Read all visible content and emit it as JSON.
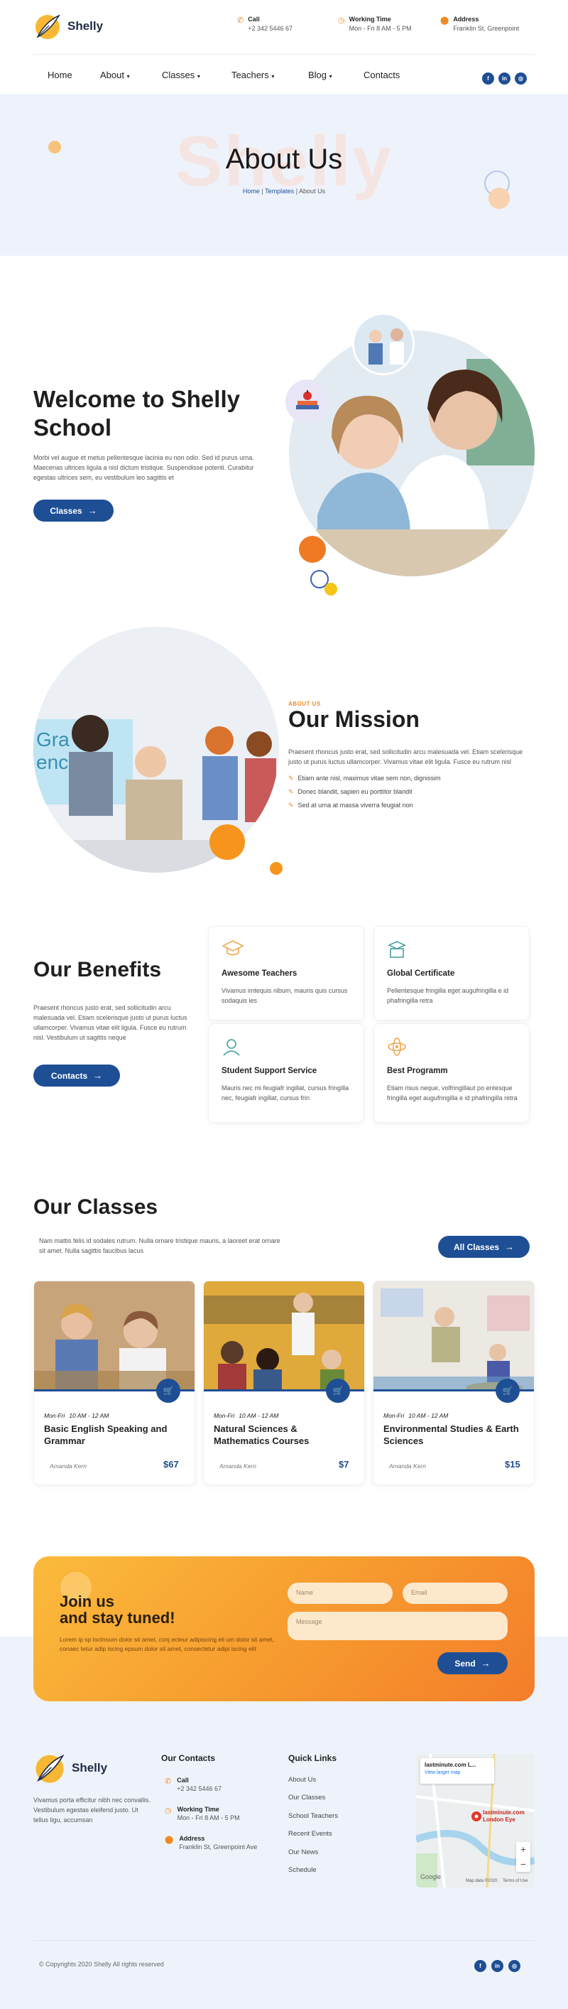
{
  "brand": {
    "name": "Shelly"
  },
  "header": {
    "call": {
      "label": "Call",
      "value": "+2 342 5446 67"
    },
    "hours": {
      "label": "Working Time",
      "value": "Mon - Fri 8 AM - 5 PM"
    },
    "address": {
      "label": "Address",
      "value": "Franklin St, Greenpoint"
    }
  },
  "nav": {
    "items": [
      "Home",
      "About",
      "Classes",
      "Teachers",
      "Blog",
      "Contacts"
    ]
  },
  "social": {
    "facebook": "f",
    "linkedin": "in",
    "instagram": "◎"
  },
  "hero": {
    "bg_text": "Shelly",
    "title": "About Us",
    "crumb_home": "Home",
    "crumb_sep1": "|",
    "crumb_templates": "Templates",
    "crumb_sep2": "|",
    "crumb_current": "About Us"
  },
  "welcome": {
    "title_line1": "Welcome to Shelly",
    "title_line2": "School",
    "text": "Morbi vel augue et metus pellentesque lacinia eu non odio. Sed id purus urna. Maecenas ultrices ligula a nisl dictum tristique. Suspendisse potenti. Curabitur egestas ultrices sem, eu vestibulum leo sagittis et",
    "button": "Classes"
  },
  "mission": {
    "eyebrow": "ABOUT US",
    "title": "Our Mission",
    "text": "Praesent rhoncus justo erat, sed sollicitudin arcu malesuada vel. Etiam scelerisque justo ut purus luctus ullamcorper. Vivamus vitae elit ligula. Fusce eu rutrum nisl",
    "bullets": [
      "Etiam ante nisl, maximus vitae sem non, dignissim",
      "Donec blandit, sapien eu porttitor blandit",
      "Sed at urna at massa viverra feugiat non"
    ],
    "image_text": "Gra\nenc"
  },
  "benefits": {
    "title": "Our Benefits",
    "text": "Praesent rhoncus justo erat, sed sollicitudin arcu malesuada vel. Etiam scelerisque justo ut purus luctus ullamcorper. Vivamus vitae elit ligula. Fusce eu rutrum nisl. Vestibulum ut sagittis neque",
    "button": "Contacts",
    "cards": [
      {
        "title": "Awesome Teachers",
        "text": "Vivamus imtequis nibum, mauris quis cursus sodaquis ies",
        "icon": "graduation-cap-icon"
      },
      {
        "title": "Global Certificate",
        "text": "Pellentesque fringilla eget augufringilla e id phafringilla retra",
        "icon": "certificate-icon"
      },
      {
        "title": "Student Support Service",
        "text": "Mauris nec mi feugiafr ingillat, cursus fringilla nec, feugiafr ingillat, cursus frin",
        "icon": "support-icon"
      },
      {
        "title": "Best Programm",
        "text": "Etiam risus neque, volfringillaut po entesque fringilla eget augufringilla e id phafringilla retra",
        "icon": "atom-icon"
      }
    ]
  },
  "classes": {
    "title": "Our Classes",
    "text": "Nam mattis felis id sodales rutrum. Nulla ornare tristique mauris, a laoreet erat ornare sit amet. Nulla sagittis faucibus lacus",
    "button": "All Classes",
    "items": [
      {
        "days": "Mon-Fri",
        "time": "10 AM - 12 AM",
        "name": "Basic English Speaking and Grammar",
        "author": "Amanda Kern",
        "price": "$67"
      },
      {
        "days": "Mon-Fri",
        "time": "10 AM - 12 AM",
        "name": "Natural Sciences & Mathematics Courses",
        "author": "Amanda Kern",
        "price": "$7"
      },
      {
        "days": "Mon-Fri",
        "time": "10 AM - 12 AM",
        "name": "Environmental Studies & Earth Sciences",
        "author": "Amanda Kern",
        "price": "$15"
      }
    ]
  },
  "newsletter": {
    "title_line1": "Join us",
    "title_line2": "and stay tuned!",
    "text": "Lorem ip sp loctnoum dolor sit amet, conj ecteur adipiscing eli um dolor sit amet, conaec tetur adip iscing epsum dolor sit amet, consectetur adipi iscing elit",
    "name_placeholder": "Name",
    "email_placeholder": "Email",
    "message_placeholder": "Message",
    "button": "Send"
  },
  "footer": {
    "about": "Vivamus porta efficitur nibh nec convallis. Vestibulum egestas eleifend justo. Ut tellus ligu, accumsan",
    "contacts_title": "Our Contacts",
    "call": {
      "label": "Call",
      "value": "+2 342 5446 67"
    },
    "hours": {
      "label": "Working Time",
      "value": "Mon - Fri 8 AM - 5 PM"
    },
    "address": {
      "label": "Address",
      "value": "Franklin St, Greenpoint Ave"
    },
    "links_title": "Quick Links",
    "links": [
      "About Us",
      "Our Classes",
      "School Teachers",
      "Recent Events",
      "Our News",
      "Schedule"
    ],
    "map": {
      "title": "lastminute.com L...",
      "link": "View larger map",
      "pin": "lastminute.com London Eye",
      "google": "Google",
      "data": "Map data ©2020",
      "terms": "Terms of Use"
    },
    "copyright": "© Copyrights 2020 Shelly All rights reserved"
  },
  "colors": {
    "primary": "#1e4f95",
    "accent": "#f08a24",
    "hero_bg": "#eef3fb"
  }
}
